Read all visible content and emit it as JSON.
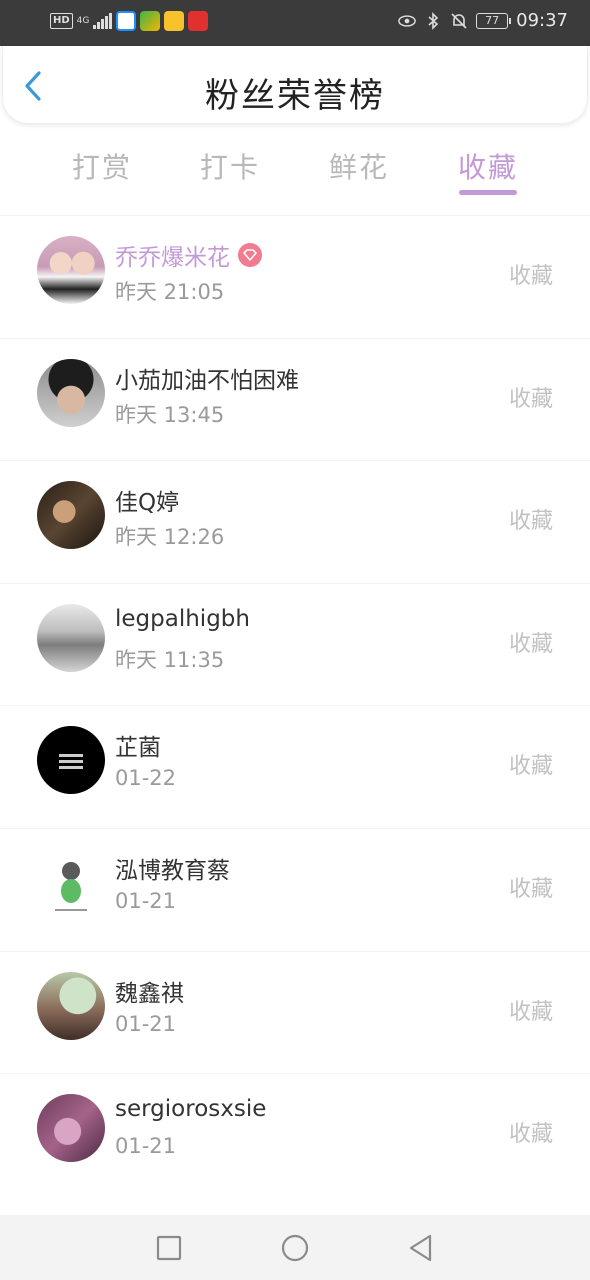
{
  "status_bar": {
    "hd": "HD",
    "network": "4G",
    "battery": "77",
    "time": "09:37"
  },
  "header": {
    "title": "粉丝荣誉榜"
  },
  "tabs": [
    {
      "label": "打赏"
    },
    {
      "label": "打卡"
    },
    {
      "label": "鲜花"
    },
    {
      "label": "收藏"
    }
  ],
  "active_tab": "收藏",
  "accent_color": "#c39ad8",
  "rows": [
    {
      "name": "乔乔爆米花",
      "time": "昨天 21:05",
      "action": "收藏"
    },
    {
      "name": "小茄加油不怕困难",
      "time": "昨天 13:45",
      "action": "收藏"
    },
    {
      "name": "佳Q婷",
      "time": "昨天 12:26",
      "action": "收藏"
    },
    {
      "name": "legpalhigbh",
      "time": "昨天 11:35",
      "action": "收藏"
    },
    {
      "name": "芷菌",
      "time": "01-22",
      "action": "收藏"
    },
    {
      "name": "泓博教育蔡",
      "time": "01-21",
      "action": "收藏"
    },
    {
      "name": "魏鑫祺",
      "time": "01-21",
      "action": "收藏"
    },
    {
      "name": "sergiorosxsie",
      "time": "01-21",
      "action": "收藏"
    }
  ]
}
